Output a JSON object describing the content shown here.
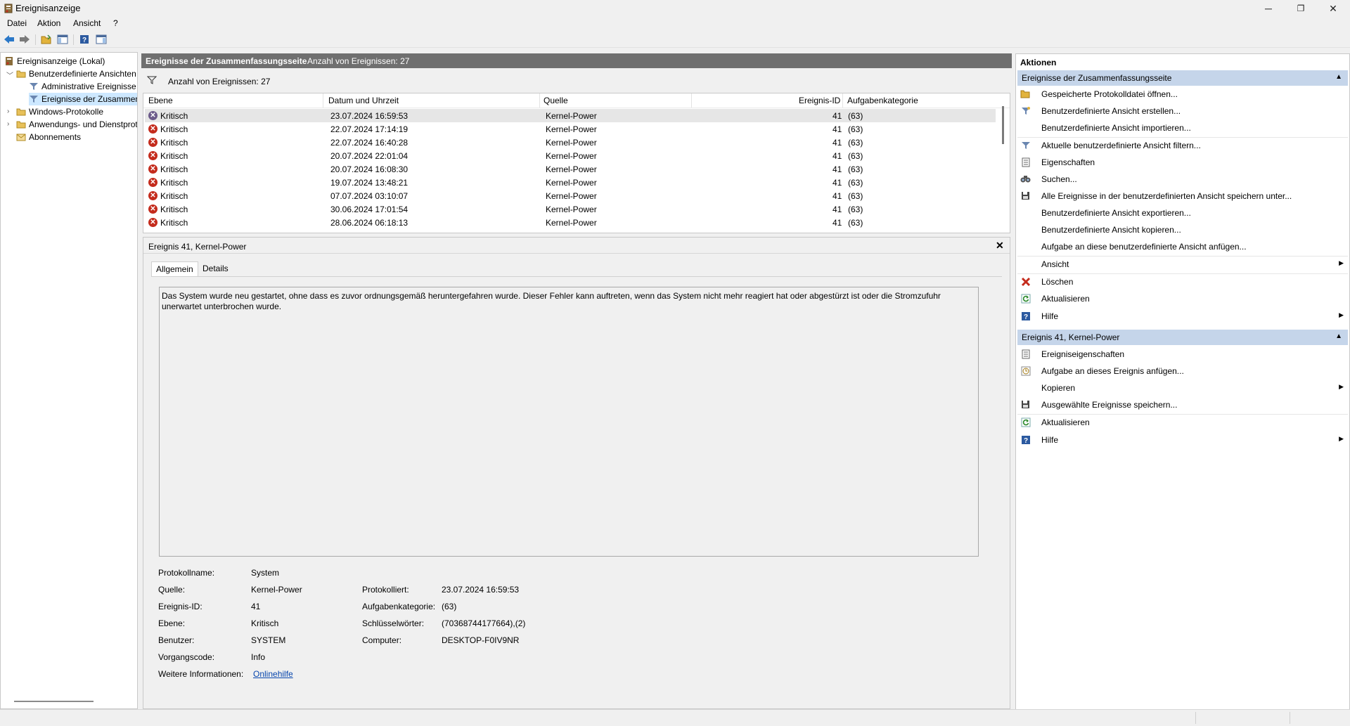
{
  "window": {
    "title": "Ereignisanzeige",
    "minimize": "─",
    "maximize": "❐",
    "close": "✕"
  },
  "menu": [
    "Datei",
    "Aktion",
    "Ansicht",
    "?"
  ],
  "tree": {
    "items": [
      {
        "label": "Ereignisanzeige (Lokal)"
      },
      {
        "label": "Benutzerdefinierte Ansichten"
      },
      {
        "label": "Administrative Ereignisse"
      },
      {
        "label": "Ereignisse der Zusammenfassungsseite"
      },
      {
        "label": "Windows-Protokolle"
      },
      {
        "label": "Anwendungs- und Dienstprotokolle"
      },
      {
        "label": "Abonnements"
      }
    ]
  },
  "center": {
    "header_title": "Ereignisse der Zusammenfassungsseite",
    "header_count": "Anzahl von Ereignissen: 27",
    "filter_text": "Anzahl von Ereignissen: 27",
    "columns": [
      "Ebene",
      "Datum und Uhrzeit",
      "Quelle",
      "Ereignis-ID",
      "Aufgabenkategorie"
    ],
    "rows": [
      {
        "level": "Kritisch",
        "datetime": "23.07.2024 16:59:53",
        "source": "Kernel-Power",
        "id": "41",
        "category": "(63)"
      },
      {
        "level": "Kritisch",
        "datetime": "22.07.2024 17:14:19",
        "source": "Kernel-Power",
        "id": "41",
        "category": "(63)"
      },
      {
        "level": "Kritisch",
        "datetime": "22.07.2024 16:40:28",
        "source": "Kernel-Power",
        "id": "41",
        "category": "(63)"
      },
      {
        "level": "Kritisch",
        "datetime": "20.07.2024 22:01:04",
        "source": "Kernel-Power",
        "id": "41",
        "category": "(63)"
      },
      {
        "level": "Kritisch",
        "datetime": "20.07.2024 16:08:30",
        "source": "Kernel-Power",
        "id": "41",
        "category": "(63)"
      },
      {
        "level": "Kritisch",
        "datetime": "19.07.2024 13:48:21",
        "source": "Kernel-Power",
        "id": "41",
        "category": "(63)"
      },
      {
        "level": "Kritisch",
        "datetime": "07.07.2024 03:10:07",
        "source": "Kernel-Power",
        "id": "41",
        "category": "(63)"
      },
      {
        "level": "Kritisch",
        "datetime": "30.06.2024 17:01:54",
        "source": "Kernel-Power",
        "id": "41",
        "category": "(63)"
      },
      {
        "level": "Kritisch",
        "datetime": "28.06.2024 06:18:13",
        "source": "Kernel-Power",
        "id": "41",
        "category": "(63)"
      }
    ]
  },
  "detail": {
    "title": "Ereignis 41, Kernel-Power",
    "close": "✕",
    "tabs": [
      "Allgemein",
      "Details"
    ],
    "description": "Das System wurde neu gestartet, ohne dass es zuvor ordnungsgemäß heruntergefahren wurde. Dieser Fehler kann auftreten, wenn das System nicht mehr reagiert hat oder abgestürzt ist oder die Stromzufuhr unerwartet unterbrochen wurde.",
    "fields": {
      "protokollname_label": "Protokollname:",
      "protokollname": "System",
      "quelle_label": "Quelle:",
      "quelle": "Kernel-Power",
      "protokolliert_label": "Protokolliert:",
      "protokolliert": "23.07.2024 16:59:53",
      "ereignisid_label": "Ereignis-ID:",
      "ereignisid": "41",
      "aufgabenkategorie_label": "Aufgabenkategorie:",
      "aufgabenkategorie": "(63)",
      "ebene_label": "Ebene:",
      "ebene": "Kritisch",
      "schluesselwoerter_label": "Schlüsselwörter:",
      "schluesselwoerter": "(70368744177664),(2)",
      "benutzer_label": "Benutzer:",
      "benutzer": "SYSTEM",
      "computer_label": "Computer:",
      "computer": "DESKTOP-F0IV9NR",
      "vorgangscode_label": "Vorgangscode:",
      "vorgangscode": "Info",
      "weitere_label": "Weitere Informationen:",
      "weitere_link": "Onlinehilfe"
    }
  },
  "actions": {
    "title": "Aktionen",
    "section1": {
      "title": "Ereignisse der Zusammenfassungsseite",
      "items": [
        "Gespeicherte Protokolldatei öffnen...",
        "Benutzerdefinierte Ansicht erstellen...",
        "Benutzerdefinierte Ansicht importieren...",
        "Aktuelle benutzerdefinierte Ansicht filtern...",
        "Eigenschaften",
        "Suchen...",
        "Alle Ereignisse in der benutzerdefinierten Ansicht speichern unter...",
        "Benutzerdefinierte Ansicht exportieren...",
        "Benutzerdefinierte Ansicht kopieren...",
        "Aufgabe an diese benutzerdefinierte Ansicht anfügen...",
        "Ansicht",
        "Löschen",
        "Aktualisieren",
        "Hilfe"
      ]
    },
    "section2": {
      "title": "Ereignis 41, Kernel-Power",
      "items": [
        "Ereigniseigenschaften",
        "Aufgabe an dieses Ereignis anfügen...",
        "Kopieren",
        "Ausgewählte Ereignisse speichern...",
        "Aktualisieren",
        "Hilfe"
      ]
    }
  },
  "colors": {
    "header_bg": "#6f6f6f",
    "section_bg": "#c5d5ea",
    "critical": "#c42b1c",
    "selection": "#cde8ff"
  }
}
